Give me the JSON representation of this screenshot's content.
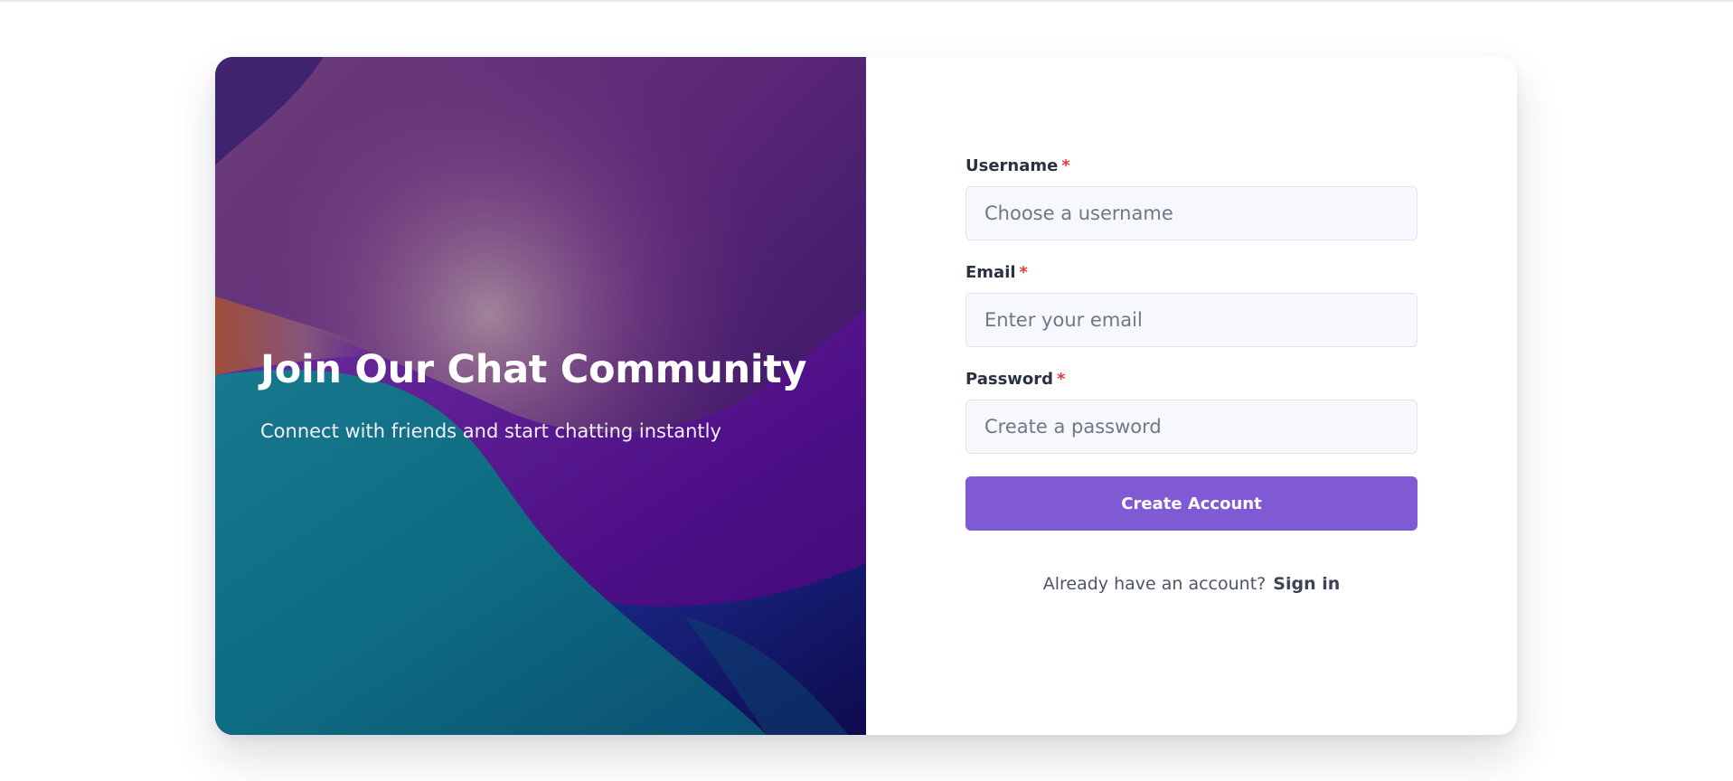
{
  "hero": {
    "title": "Join Our Chat Community",
    "subtitle": "Connect with friends and start chatting instantly",
    "background_image": "abstract-purple-teal-waves"
  },
  "form": {
    "fields": [
      {
        "label": "Username",
        "required_mark": "*",
        "placeholder": "Choose a username",
        "value": ""
      },
      {
        "label": "Email",
        "required_mark": "*",
        "placeholder": "Enter your email",
        "value": ""
      },
      {
        "label": "Password",
        "required_mark": "*",
        "placeholder": "Create a password",
        "value": ""
      }
    ],
    "submit_label": "Create Account",
    "signin_prompt": "Already have an account?",
    "signin_link": "Sign in"
  },
  "colors": {
    "accent": "#805ad5",
    "required": "#e03b3b",
    "input_bg": "#f6f8fb"
  }
}
